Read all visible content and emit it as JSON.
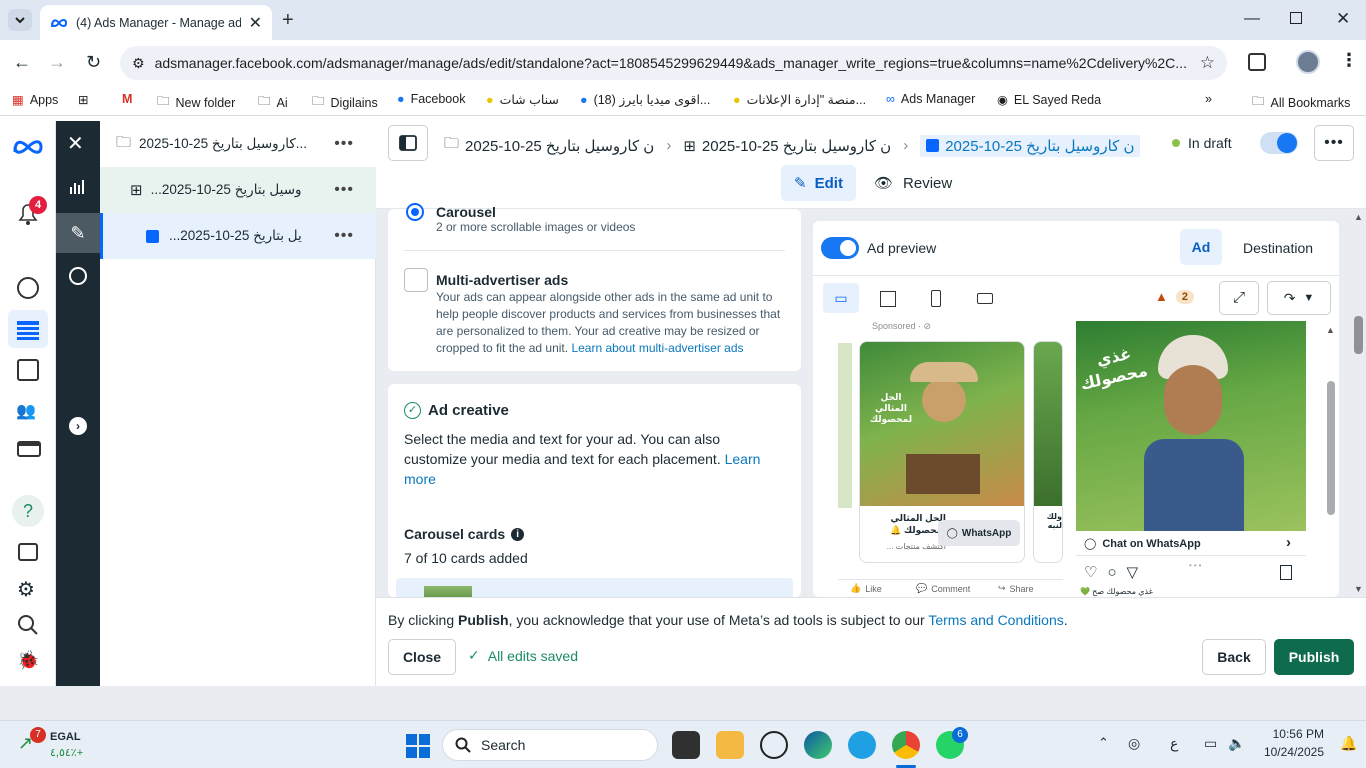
{
  "browser": {
    "tab_title": "(4) Ads Manager - Manage ads",
    "url": "adsmanager.facebook.com/adsmanager/manage/ads/edit/standalone?act=1808545299629449&ads_manager_write_regions=true&columns=name%2Cdelivery%2C...",
    "bookmarks": [
      "Apps",
      "New folder",
      "Ai",
      "Digilains",
      "Facebook",
      "سناب شات",
      "(18) اقوى ميديا بايرز...",
      "منصة \"إدارة الإعلانات...",
      "Ads Manager",
      "EL Sayed Reda"
    ],
    "all_bookmarks": "All Bookmarks"
  },
  "rail": {
    "notification_count": "4"
  },
  "tree": {
    "items": [
      {
        "label": "كاروسيل بتاريخ 25-10-2025..."
      },
      {
        "label": "...وسيل بتاريخ 25-10-2025"
      },
      {
        "label": "...يل بتاريخ 25-10-2025"
      }
    ]
  },
  "breadcrumb": {
    "items": [
      "ن كاروسيل بتاريخ 25-10-2025",
      "ن كاروسيل بتاريخ 25-10-2025",
      "ن كاروسيل بتاريخ 25-10-2025"
    ],
    "status": "In draft"
  },
  "modes": {
    "edit": "Edit",
    "review": "Review"
  },
  "format": {
    "carousel_label": "Carousel",
    "carousel_desc": "2 or more scrollable images or videos",
    "multi_label": "Multi-advertiser ads",
    "multi_desc": "Your ads can appear alongside other ads in the same ad unit to help people discover products and services from businesses that are personalized to them. Your ad creative may be resized or cropped to fit the ad unit.",
    "multi_link": "Learn about multi-advertiser ads"
  },
  "creative": {
    "title": "Ad creative",
    "desc": "Select the media and text for your ad. You can also customize your media and text for each placement.",
    "learn_more": "Learn more",
    "carousel_cards": "Carousel cards",
    "cards_count": "7 of 10 cards added"
  },
  "preview": {
    "toggle_label": "Ad preview",
    "tab_ad": "Ad",
    "tab_destination": "Destination",
    "warning_count": "2",
    "sponsored": "Sponsored · ⊘",
    "card_headline": "الحل المثالي لمحصولك 🔔",
    "card_sub": "اكتشف منتجات ...",
    "whatsapp_btn": "WhatsApp",
    "side_card_text": "ولك لنبه",
    "like": "Like",
    "comment": "Comment",
    "share": "Share",
    "chat_on_whatsapp": "Chat on WhatsApp",
    "story_caption": "غذي محصولك صح 💚",
    "image1_text": "الحل المثالي لمحصولك",
    "image2_text": "غذي محصولك"
  },
  "footer": {
    "notice_pre": "By clicking ",
    "notice_bold": "Publish",
    "notice_mid": ", you acknowledge that your use of Meta’s ad tools is subject to our ",
    "terms": "Terms and Conditions",
    "notice_end": ".",
    "close": "Close",
    "saved": "All edits saved",
    "back": "Back",
    "publish": "Publish"
  },
  "taskbar": {
    "stock_name": "EGAL",
    "stock_change": "٤,٥٤٪+",
    "stock_badge": "7",
    "search": "Search",
    "whatsapp_badge": "6",
    "lang": "ع",
    "time": "10:56 PM",
    "date": "10/24/2025"
  },
  "colors": {
    "meta_blue": "#0866ff",
    "publish_green": "#0f6b4d",
    "dark_rail": "#1c2b33",
    "link": "#0a78be"
  }
}
